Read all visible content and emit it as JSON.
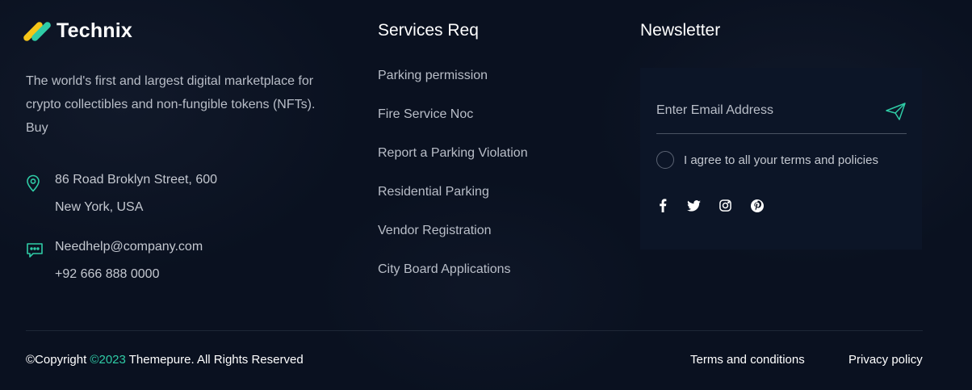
{
  "brand": {
    "name": "Technix",
    "description": "The world's first and largest digital marketplace for crypto collectibles and non-fungible tokens (NFTs). Buy"
  },
  "contact": {
    "address_line1": "86 Road Broklyn Street, 600",
    "address_line2": "New York, USA",
    "email": "Needhelp@company.com",
    "phone": "+92 666 888 0000"
  },
  "services": {
    "title": "Services Req",
    "items": [
      "Parking permission",
      "Fire Service Noc",
      "Report a Parking Violation",
      "Residential Parking",
      "Vendor Registration",
      "City Board Applications"
    ]
  },
  "newsletter": {
    "title": "Newsletter",
    "email_placeholder": "Enter Email Address",
    "email_value": "",
    "agree_label": "I agree to all your terms and policies",
    "socials": [
      "facebook-icon",
      "twitter-icon",
      "instagram-icon",
      "pinterest-icon"
    ]
  },
  "footer": {
    "copyright_prefix": "©Copyright ",
    "copyright_year": "©2023",
    "copyright_suffix": " Themepure. All Rights Reserved",
    "terms": "Terms and conditions",
    "privacy": "Privacy policy"
  },
  "colors": {
    "background": "#0a1120",
    "accent": "#2fcca6",
    "logo_yellow": "#f5c518",
    "text_muted": "#b9bec8",
    "heading": "#ffffff"
  }
}
